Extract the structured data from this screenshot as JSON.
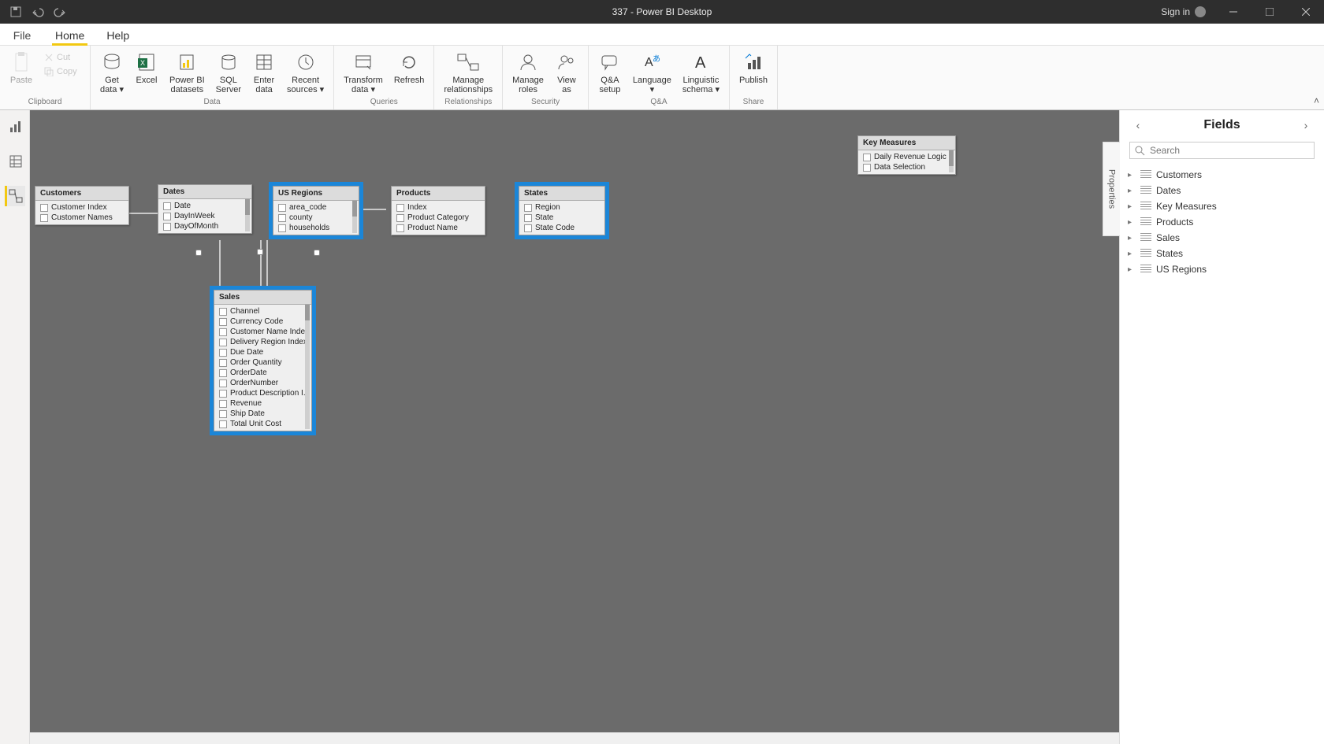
{
  "appTitle": "337 - Power BI Desktop",
  "signin": "Sign in",
  "tabs": {
    "file": "File",
    "home": "Home",
    "help": "Help"
  },
  "ribbon": {
    "clipboard": {
      "paste": "Paste",
      "cut": "Cut",
      "copy": "Copy",
      "group": "Clipboard"
    },
    "data": {
      "group": "Data",
      "getdata": "Get\ndata ▾",
      "excel": "Excel",
      "pbids": "Power BI\ndatasets",
      "sql": "SQL\nServer",
      "enter": "Enter\ndata",
      "recent": "Recent\nsources ▾"
    },
    "queries": {
      "group": "Queries",
      "transform": "Transform\ndata ▾",
      "refresh": "Refresh"
    },
    "relationships": {
      "group": "Relationships",
      "manage": "Manage\nrelationships"
    },
    "security": {
      "group": "Security",
      "roles": "Manage\nroles",
      "view": "View\nas"
    },
    "qa": {
      "group": "Q&A",
      "setup": "Q&A\nsetup",
      "lang": "Language\n▾",
      "schema": "Linguistic\nschema ▾"
    },
    "share": {
      "group": "Share",
      "publish": "Publish"
    }
  },
  "tables": {
    "customers": {
      "title": "Customers",
      "rows": [
        "Customer Index",
        "Customer Names"
      ]
    },
    "dates": {
      "title": "Dates",
      "rows": [
        "Date",
        "DayInWeek",
        "DayOfMonth"
      ]
    },
    "usregions": {
      "title": "US Regions",
      "rows": [
        "area_code",
        "county",
        "households"
      ]
    },
    "products": {
      "title": "Products",
      "rows": [
        "Index",
        "Product Category",
        "Product Name"
      ]
    },
    "states": {
      "title": "States",
      "rows": [
        "Region",
        "State",
        "State Code"
      ]
    },
    "keymeasures": {
      "title": "Key Measures",
      "rows": [
        "Daily Revenue Logic",
        "Data Selection"
      ]
    },
    "sales": {
      "title": "Sales",
      "rows": [
        "Channel",
        "Currency Code",
        "Customer Name Index",
        "Delivery Region Index",
        "Due Date",
        "Order Quantity",
        "OrderDate",
        "OrderNumber",
        "Product Description I...",
        "Revenue",
        "Ship Date",
        "Total Unit Cost"
      ]
    }
  },
  "fieldsPane": {
    "title": "Fields",
    "searchPlaceholder": "Search",
    "items": [
      "Customers",
      "Dates",
      "Key Measures",
      "Products",
      "Sales",
      "States",
      "US Regions"
    ]
  },
  "propertiesLabel": "Properties"
}
